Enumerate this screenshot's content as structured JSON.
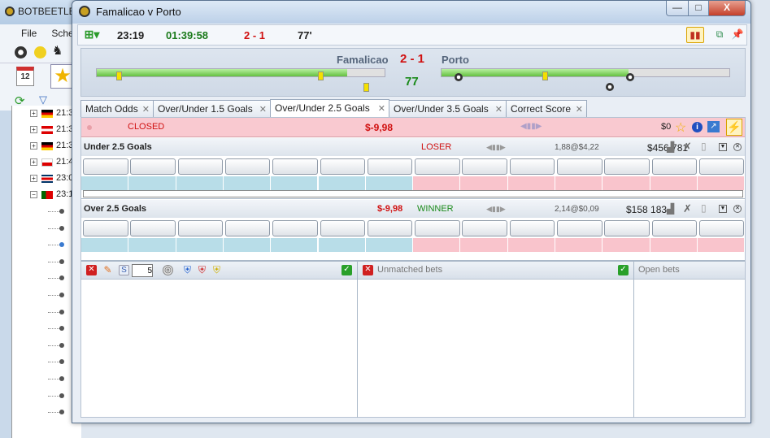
{
  "bg_app": {
    "title": "BOTBEETLE",
    "menu": [
      "File",
      "Sche"
    ],
    "tree_rows": [
      {
        "time": "21:3",
        "flag": "germany"
      },
      {
        "time": "21:3",
        "flag": "austria"
      },
      {
        "time": "21:3",
        "flag": "germany"
      },
      {
        "time": "21:4",
        "flag": "poland"
      },
      {
        "time": "23:0",
        "flag": "costa-rica"
      },
      {
        "time": "23:1",
        "flag": "portugal"
      }
    ],
    "calendar_day": "12"
  },
  "window": {
    "title": "Famalicao v Porto",
    "controls": {
      "minimize": "—",
      "maximize": "□",
      "close": "X"
    }
  },
  "toolbar": {
    "start_time": "23:19",
    "countdown": "01:39:58",
    "score": "2 - 1",
    "minute": "77'"
  },
  "scoreboard": {
    "home": "Famalicao",
    "away": "Porto",
    "score": "2 - 1",
    "minute": "77",
    "first_half_ticks": [
      "5",
      "10",
      "15",
      "20",
      "25",
      "30",
      "35",
      "40",
      "45",
      "47"
    ],
    "second_half_ticks": [
      "50",
      "55",
      "60",
      "65",
      "70",
      "75",
      "80",
      "85",
      "90"
    ],
    "first_half_progress": 0.87,
    "second_half_progress": 0.65
  },
  "tabs": [
    {
      "label": "Match Odds",
      "active": false
    },
    {
      "label": "Over/Under 1.5 Goals",
      "active": false
    },
    {
      "label": "Over/Under 2.5 Goals",
      "active": true
    },
    {
      "label": "Over/Under 3.5 Goals",
      "active": false
    },
    {
      "label": "Correct Score",
      "active": false
    }
  ],
  "market": {
    "status": "CLOSED",
    "pl": "$-9,98",
    "pl_value": "$0"
  },
  "selections": [
    {
      "name": "Under 2.5 Goals",
      "pl": "",
      "result": "LOSER",
      "result_color": "#d01010",
      "odds": "1,88@$4,22",
      "matched": "$456 781"
    },
    {
      "name": "Over 2.5 Goals",
      "pl": "$-9,98",
      "result": "WINNER",
      "result_color": "#1a8a1a",
      "odds": "2,14@$0,09",
      "matched": "$158 183"
    }
  ],
  "bets": {
    "stake_input": "5",
    "unmatched_label": "Unmatched bets",
    "open_label": "Open bets"
  }
}
